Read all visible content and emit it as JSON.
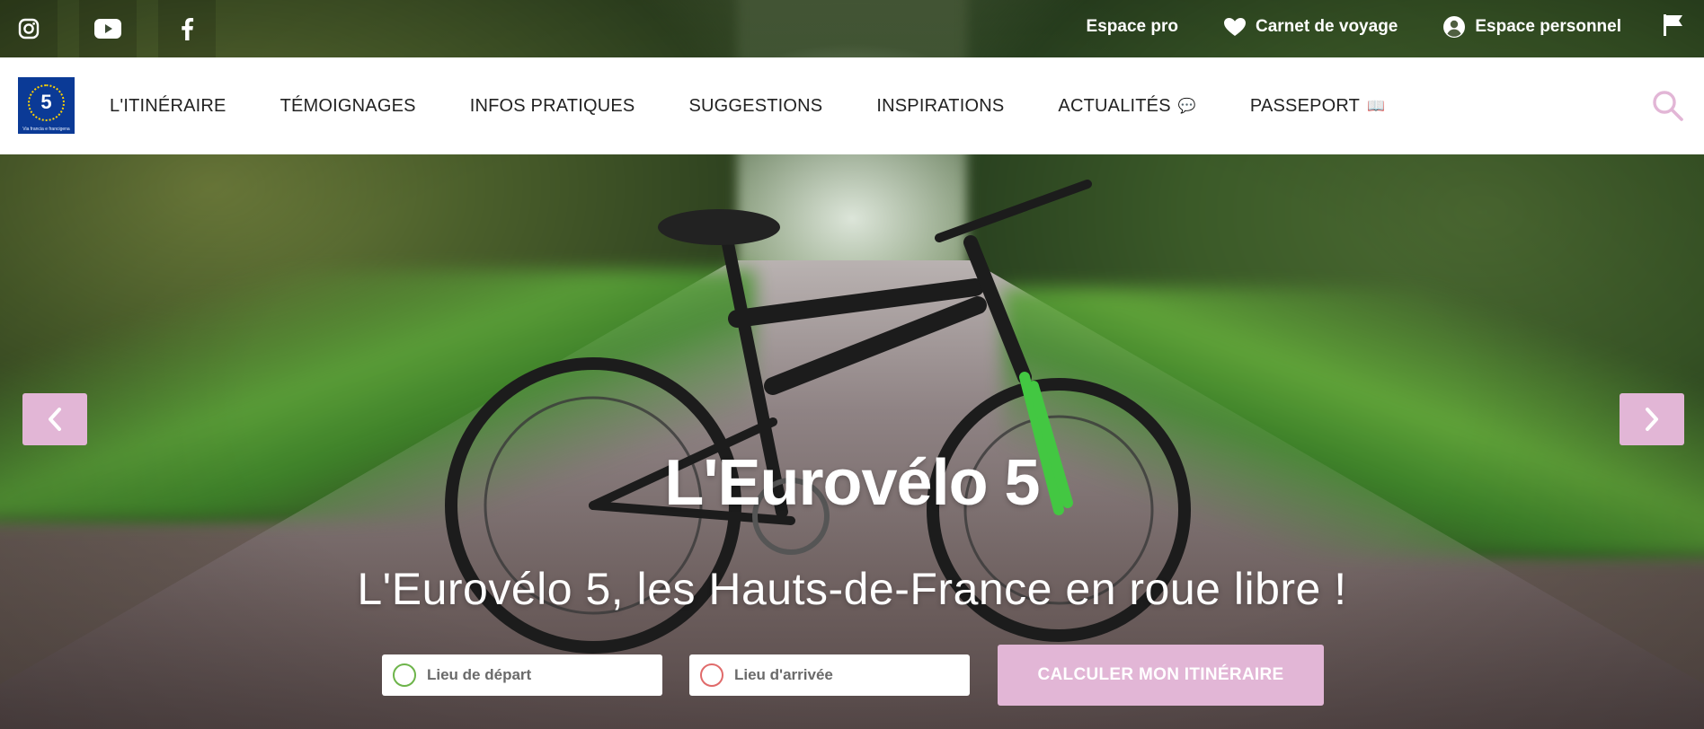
{
  "colors": {
    "accent_pink": "#e2b6d6",
    "logo_blue": "#0b3a96",
    "departure_green": "#6db44a",
    "arrival_red": "#e06a6a"
  },
  "social": [
    {
      "icon": "instagram-icon"
    },
    {
      "icon": "youtube-icon"
    },
    {
      "icon": "facebook-icon"
    }
  ],
  "utility": {
    "espace_pro": "Espace pro",
    "carnet": "Carnet de voyage",
    "espace_perso": "Espace personnel",
    "flag_icon": "flag-icon"
  },
  "logo": {
    "number": "5",
    "caption": "Via francia e francigena"
  },
  "menu": [
    {
      "label": "L'ITINÉRAIRE"
    },
    {
      "label": "TÉMOIGNAGES"
    },
    {
      "label": "INFOS PRATIQUES"
    },
    {
      "label": "SUGGESTIONS"
    },
    {
      "label": "INSPIRATIONS"
    },
    {
      "label": "ACTUALITÉS",
      "emoji": "💬"
    },
    {
      "label": "PASSEPORT",
      "emoji": "📖"
    }
  ],
  "hero": {
    "title": "L'Eurovélo 5",
    "subtitle": "L'Eurovélo 5, les Hauts-de-France en roue libre !",
    "prev_icon": "chevron-left-icon",
    "next_icon": "chevron-right-icon"
  },
  "form": {
    "departure_placeholder": "Lieu de départ",
    "departure_value": "",
    "arrival_placeholder": "Lieu d'arrivée",
    "arrival_value": "",
    "submit_label": "CALCULER MON ITINÉRAIRE"
  }
}
